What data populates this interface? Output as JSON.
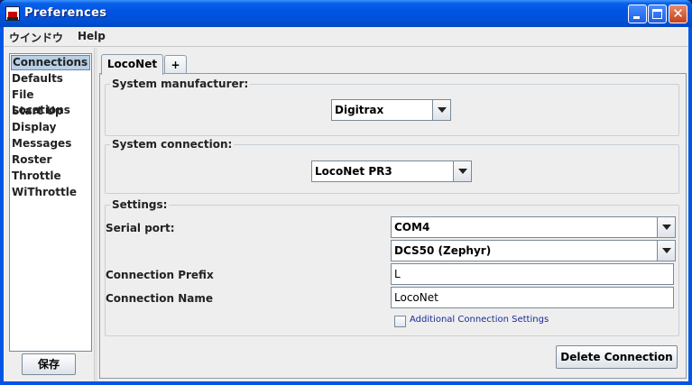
{
  "window": {
    "title": "Preferences"
  },
  "menubar": {
    "items": [
      "ウインドウ",
      "Help"
    ]
  },
  "sidebar": {
    "items": [
      "Connections",
      "Defaults",
      "File Locations",
      "Start Up",
      "Display",
      "Messages",
      "Roster",
      "Throttle",
      "WiThrottle"
    ],
    "selected": "Connections",
    "save_label": "保存"
  },
  "tabs": [
    {
      "label": "LocoNet",
      "active": true
    },
    {
      "label": "+",
      "active": false
    }
  ],
  "manufacturer": {
    "title": "System manufacturer:",
    "value": "Digitrax"
  },
  "connection": {
    "title": "System connection:",
    "value": "LocoNet PR3"
  },
  "settings": {
    "title": "Settings:",
    "serial_port_label": "Serial port:",
    "serial_port_value": "COM4",
    "command_station_value": "DCS50 (Zephyr)",
    "prefix_label": "Connection Prefix",
    "prefix_value": "L",
    "name_label": "Connection Name",
    "name_value": "LocoNet",
    "additional_label": "Additional Connection Settings",
    "additional_checked": false
  },
  "delete_label": "Delete Connection"
}
